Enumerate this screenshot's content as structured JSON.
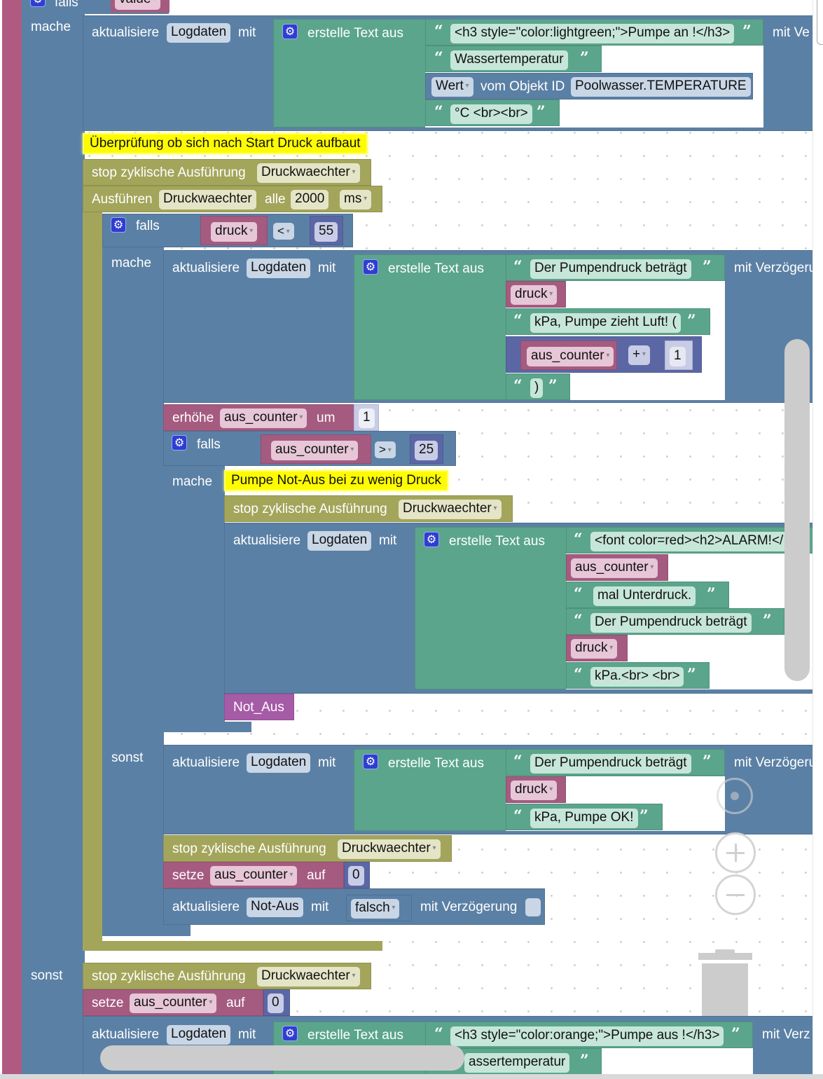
{
  "outer": {
    "falls_label": "falls",
    "value_var": "value",
    "mache_label": "mache",
    "sonst_label": "sonst"
  },
  "block1": {
    "aktualisiere": "aktualisiere",
    "target": "Logdaten",
    "mit": "mit",
    "erstelle": "erstelle Text aus",
    "items": [
      "<h3 style=\"color:lightgreen;\">Pumpe an !</h3>",
      "Wassertemperatur",
      "°C <br><br>"
    ],
    "wert_dropdown": "Wert",
    "vom_objekt": "vom Objekt ID",
    "object_id": "Poolwasser.TEMPERATURE",
    "delay_label": "mit Ve"
  },
  "comment1": "Überprüfung ob sich nach Start Druck aufbaut",
  "stop1": {
    "label": "stop zyklische Ausführung",
    "target": "Druckwaechter"
  },
  "interval": {
    "label": "Ausführen",
    "name": "Druckwaechter",
    "alle": "alle",
    "value": "2000",
    "unit": "ms"
  },
  "if1": {
    "falls": "falls",
    "var": "druck",
    "op": "<",
    "value": "55",
    "mache": "mache",
    "sonst": "sonst"
  },
  "log2": {
    "aktualisiere": "aktualisiere",
    "target": "Logdaten",
    "mit": "mit",
    "erstelle": "erstelle Text aus",
    "text1": "Der Pumpendruck beträgt",
    "var1": "druck",
    "text2": "kPa, Pumpe zieht Luft! (",
    "math_var": "aus_counter",
    "math_op": "+",
    "math_val": "1",
    "text3": ")",
    "delay_label": "mit Verzögeru"
  },
  "inc": {
    "label": "erhöhe",
    "var": "aus_counter",
    "um": "um",
    "value": "1"
  },
  "if2": {
    "falls": "falls",
    "var": "aus_counter",
    "op": ">",
    "value": "25",
    "mache": "mache"
  },
  "comment2": "Pumpe Not-Aus bei zu wenig Druck",
  "stop2": {
    "label": "stop zyklische Ausführung",
    "target": "Druckwaechter"
  },
  "log3": {
    "aktualisiere": "aktualisiere",
    "target": "Logdaten",
    "mit": "mit",
    "erstelle": "erstelle Text aus",
    "text1": "<font color=red><h2>ALARM!</",
    "var1": "aus_counter",
    "text2": "mal Unterdruck.",
    "text3": "Der Pumpendruck beträgt",
    "var2": "druck",
    "text4": "kPa.<br> <br>"
  },
  "notaus_fn": "Not_Aus",
  "log4": {
    "aktualisiere": "aktualisiere",
    "target": "Logdaten",
    "mit": "mit",
    "erstelle": "erstelle Text aus",
    "text1": "Der Pumpendruck beträgt",
    "var1": "druck",
    "text2": "kPa, Pumpe OK!",
    "delay_label": "mit Verzögeru"
  },
  "stop3": {
    "label": "stop zyklische Ausführung",
    "target": "Druckwaechter"
  },
  "set1": {
    "label": "setze",
    "var": "aus_counter",
    "auf": "auf",
    "value": "0"
  },
  "upd_notaus": {
    "aktualisiere": "aktualisiere",
    "target": "Not-Aus",
    "mit": "mit",
    "value": "falsch",
    "delay_label": "mit Verzögerung"
  },
  "stop4": {
    "label": "stop zyklische Ausführung",
    "target": "Druckwaechter"
  },
  "set2": {
    "label": "setze",
    "var": "aus_counter",
    "auf": "auf",
    "value": "0"
  },
  "log5": {
    "aktualisiere": "aktualisiere",
    "target": "Logdaten",
    "mit": "mit",
    "erstelle": "erstelle Text aus",
    "text1": "<h3 style=\"color:orange;\">Pumpe aus !</h3>",
    "text2": "assertemperatur",
    "delay_label": "mit Verz"
  },
  "colors": {
    "procedure": "#b05a81",
    "logic_blue": "#5b80a5",
    "text_green": "#5ba58c",
    "timer_olive": "#a3a55b",
    "variable": "#a55b80",
    "math": "#5b67a5",
    "function": "#a55ba5",
    "comment": "#fffc00"
  }
}
